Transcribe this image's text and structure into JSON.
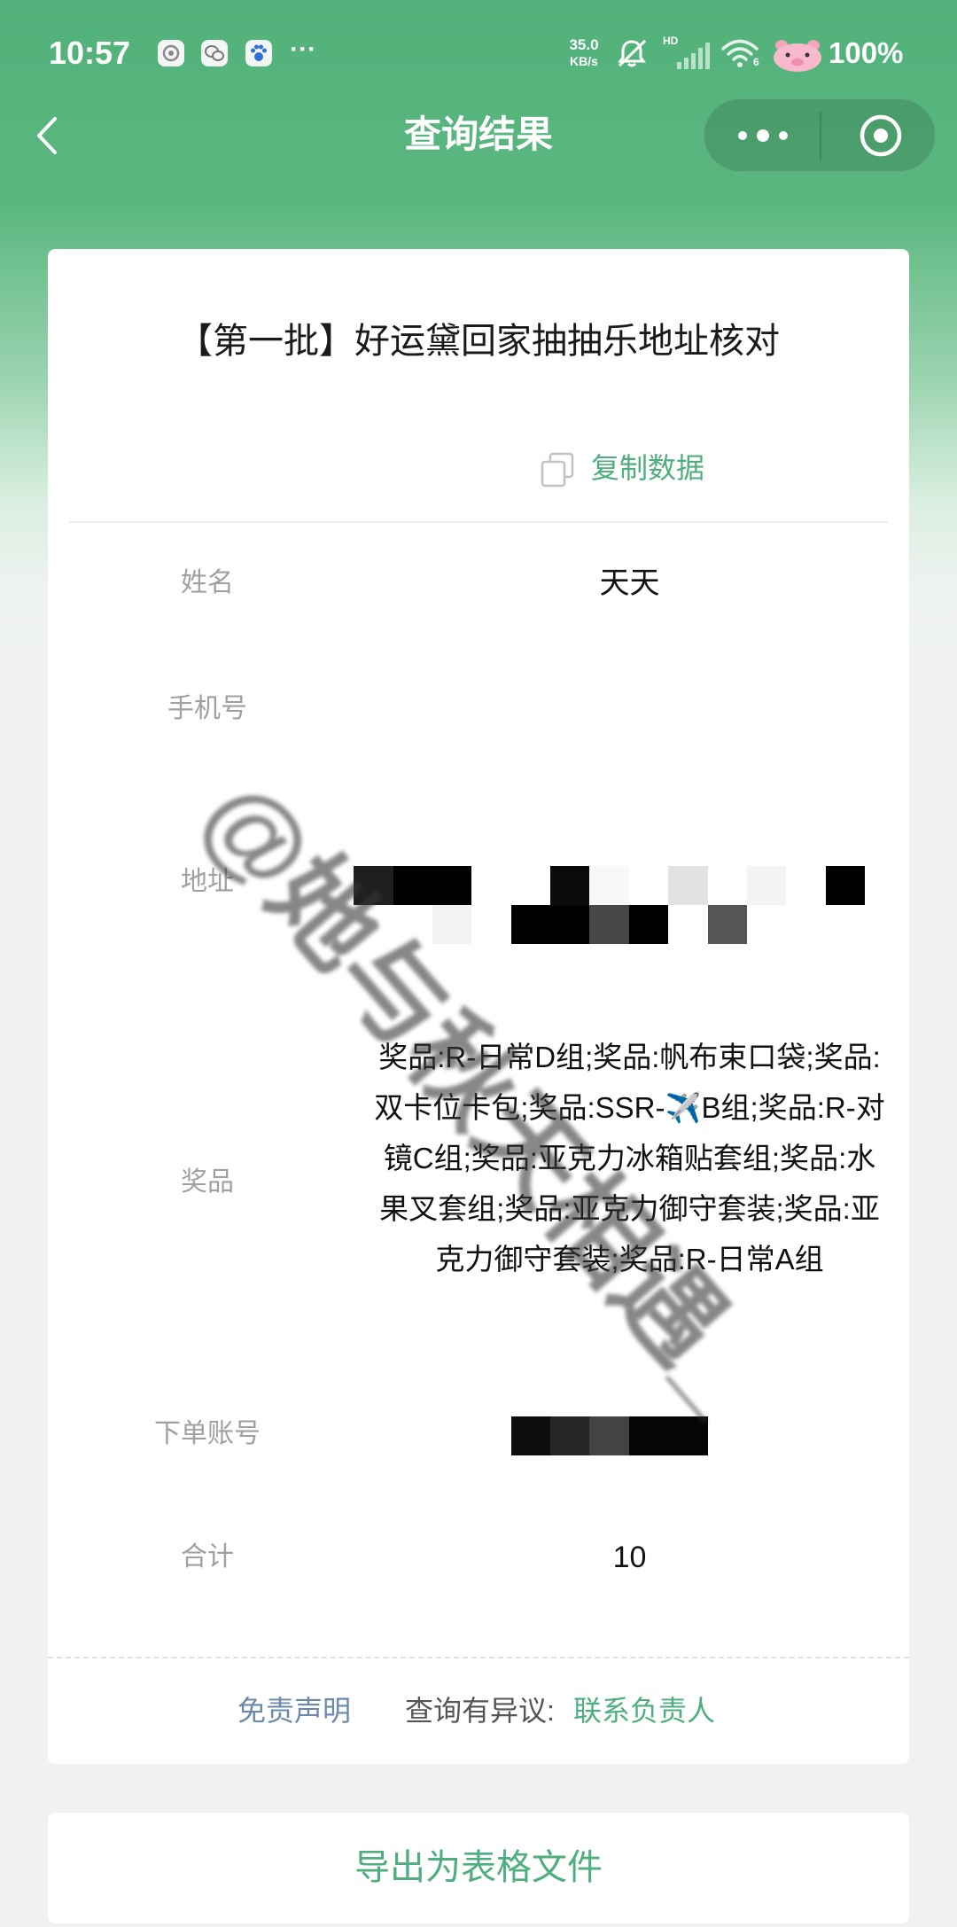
{
  "status_bar": {
    "time": "10:57",
    "overflow": "···",
    "network_speed_value": "35.0",
    "network_speed_unit": "KB/s",
    "signal_label": "HD",
    "wifi_label": "6",
    "battery": "100%"
  },
  "nav": {
    "title": "查询结果"
  },
  "result_card": {
    "title": "【第一批】好运黛回家抽抽乐地址核对",
    "copy_label": "复制数据",
    "rows": [
      {
        "label": "姓名",
        "value": "天天"
      },
      {
        "label": "手机号"
      },
      {
        "label": "地址"
      },
      {
        "label": "奖品",
        "value": "奖品:R-日常D组;奖品:帆布束口袋;奖品:双卡位卡包;奖品:SSR-✈️B组;奖品:R-对镜C组;奖品:亚克力冰箱贴套组;奖品:水果叉套组;奖品:亚克力御守套装;奖品:亚克力御守套装;奖品:R-日常A组"
      },
      {
        "label": "下单账号"
      },
      {
        "label": "合计",
        "value": "10"
      }
    ],
    "footer": {
      "disclaimer": "免责声明",
      "dispute_prefix": "查询有异议:",
      "contact": "联系负责人"
    }
  },
  "export_button": {
    "label": "导出为表格文件"
  },
  "watermark": "@她与秋天相遇_",
  "icons": {
    "back": "chevron-left-icon",
    "menu": "more-dots-icon",
    "exit": "target-circle-icon",
    "copy": "copy-icon"
  },
  "colors": {
    "header_green": "#55b57e",
    "brand_green": "#4fae7e",
    "link_blue": "#6b88ad",
    "page_background": "#f0f1f3"
  }
}
